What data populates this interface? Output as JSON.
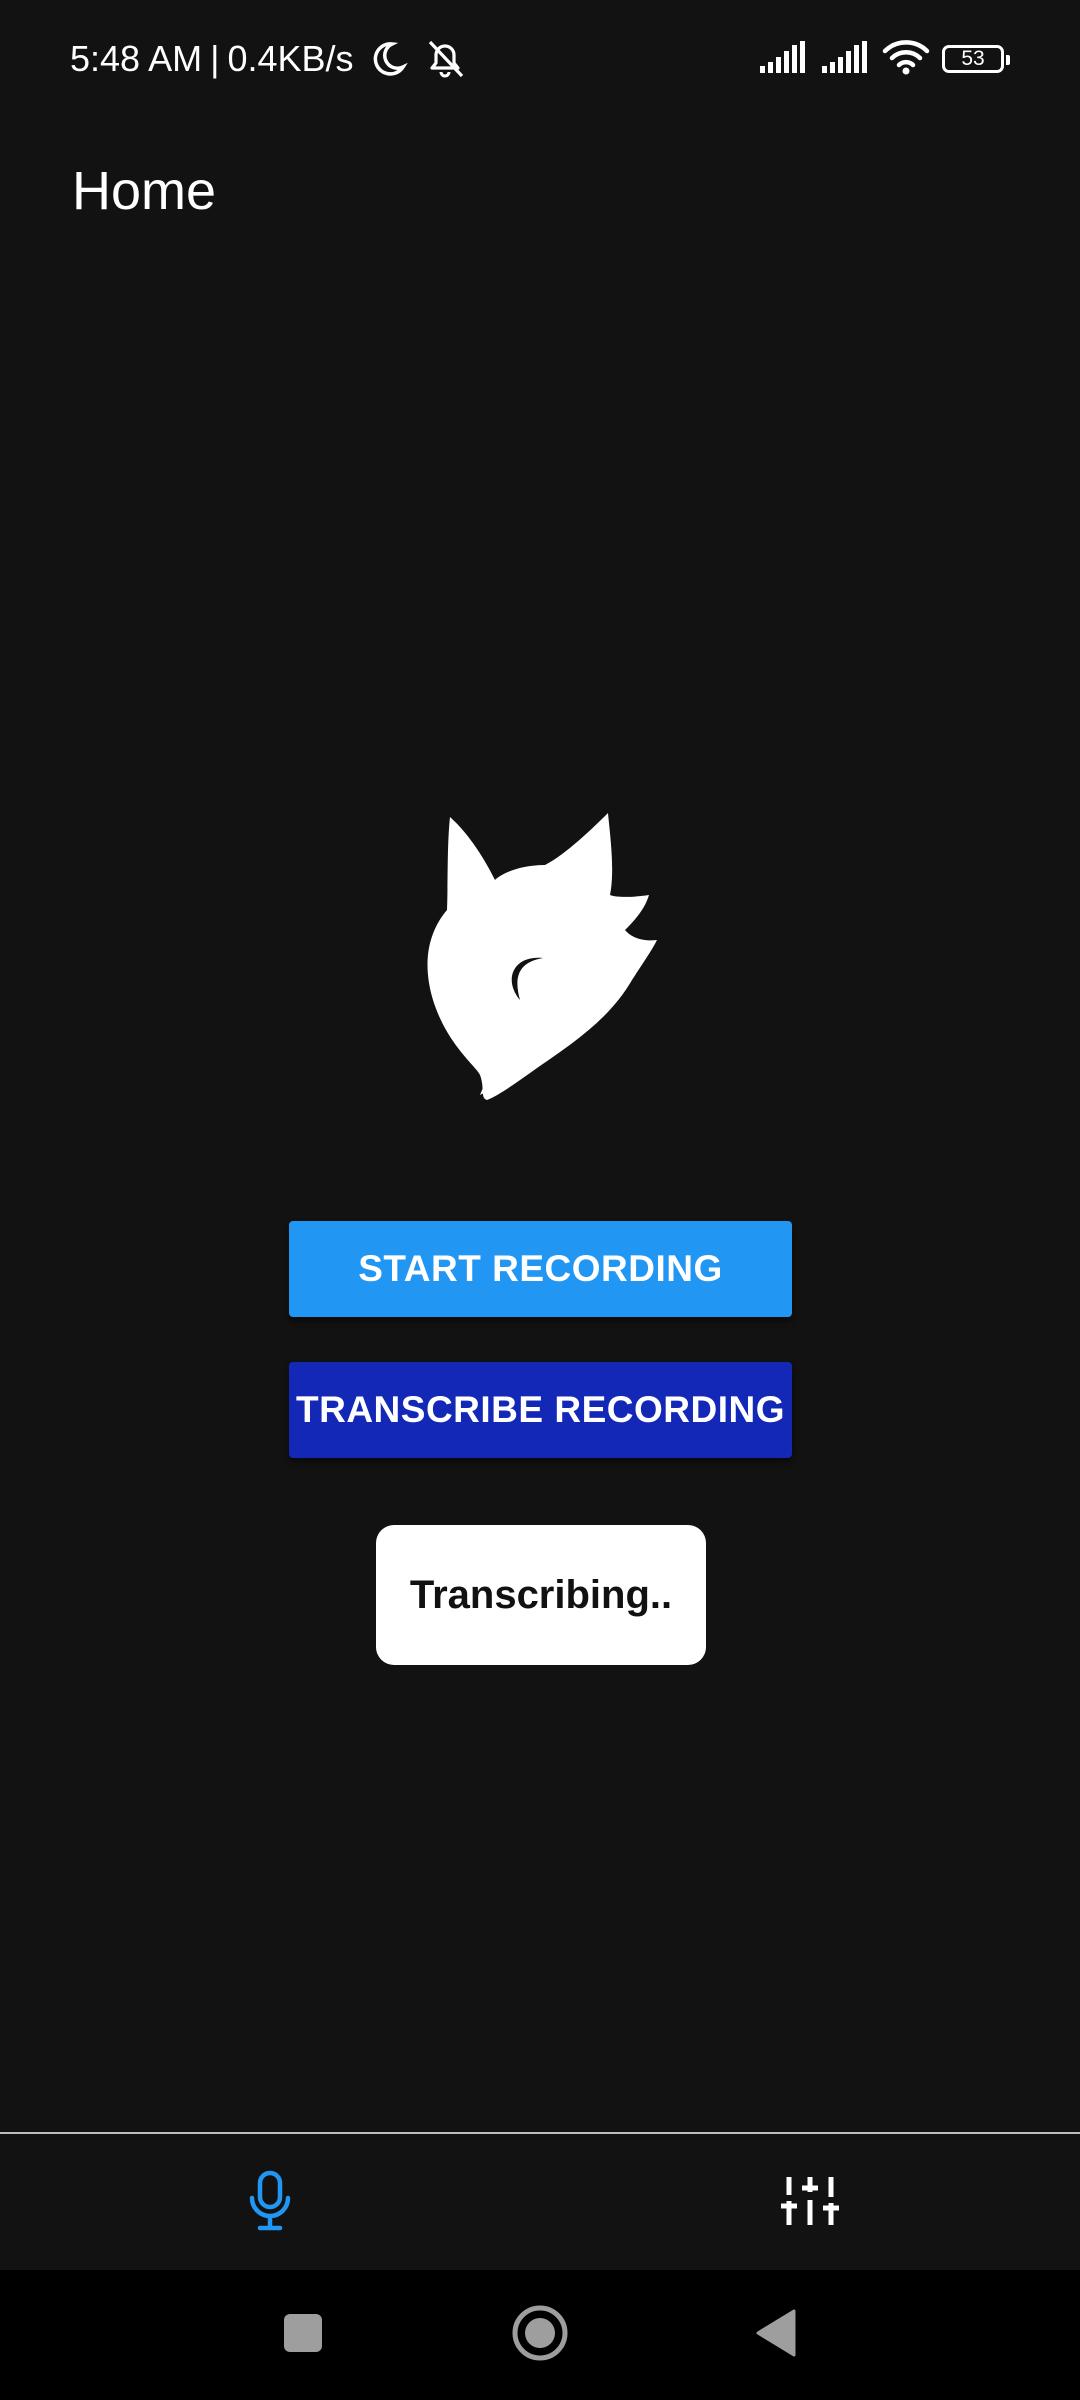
{
  "status_bar": {
    "time": "5:48 AM",
    "separator": "|",
    "network_speed": "0.4KB/s",
    "battery_level": "53",
    "icons": [
      "moon-icon",
      "bell-off-icon",
      "signal-icon",
      "signal-icon",
      "wifi-icon",
      "battery-icon"
    ]
  },
  "header": {
    "title": "Home"
  },
  "main": {
    "logo_icon": "fox-logo-icon",
    "start_button_label": "START RECORDING",
    "transcribe_button_label": "TRANSCRIBE RECORDING",
    "toast_text": "Transcribing.."
  },
  "bottom_nav": {
    "items": [
      {
        "icon": "microphone-icon",
        "active": true
      },
      {
        "icon": "sliders-icon",
        "active": false
      }
    ]
  },
  "system_nav": {
    "icons": [
      "recents-icon",
      "home-icon",
      "back-icon"
    ]
  },
  "colors": {
    "background": "#121212",
    "primary": "#2196f3",
    "secondary": "#1428b8",
    "active_nav": "#2196f3"
  }
}
